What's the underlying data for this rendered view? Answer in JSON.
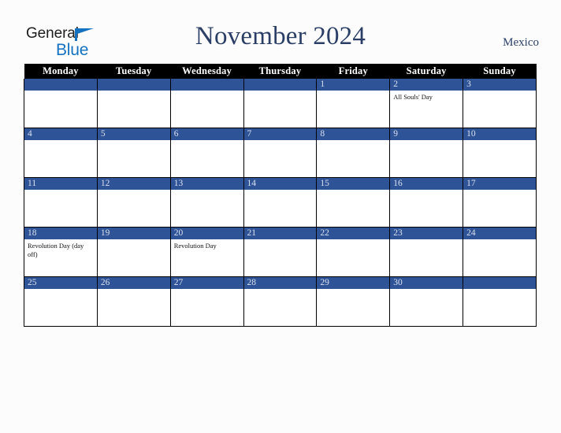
{
  "logo": {
    "word1": "General",
    "word2": "Blue",
    "triangle_icon": "triangle-right-icon",
    "color_primary": "#1472c0",
    "color_text": "#1d1d1d"
  },
  "header": {
    "title": "November 2024",
    "country": "Mexico",
    "title_color": "#2b3f66"
  },
  "calendar": {
    "header_background": "#000000",
    "daybar_background": "#2e5396",
    "weekdays": [
      "Monday",
      "Tuesday",
      "Wednesday",
      "Thursday",
      "Friday",
      "Saturday",
      "Sunday"
    ],
    "weeks": [
      [
        {
          "day": "",
          "events": []
        },
        {
          "day": "",
          "events": []
        },
        {
          "day": "",
          "events": []
        },
        {
          "day": "",
          "events": []
        },
        {
          "day": "1",
          "events": []
        },
        {
          "day": "2",
          "events": [
            "All Souls' Day"
          ]
        },
        {
          "day": "3",
          "events": []
        }
      ],
      [
        {
          "day": "4",
          "events": []
        },
        {
          "day": "5",
          "events": []
        },
        {
          "day": "6",
          "events": []
        },
        {
          "day": "7",
          "events": []
        },
        {
          "day": "8",
          "events": []
        },
        {
          "day": "9",
          "events": []
        },
        {
          "day": "10",
          "events": []
        }
      ],
      [
        {
          "day": "11",
          "events": []
        },
        {
          "day": "12",
          "events": []
        },
        {
          "day": "13",
          "events": []
        },
        {
          "day": "14",
          "events": []
        },
        {
          "day": "15",
          "events": []
        },
        {
          "day": "16",
          "events": []
        },
        {
          "day": "17",
          "events": []
        }
      ],
      [
        {
          "day": "18",
          "events": [
            "Revolution Day (day off)"
          ]
        },
        {
          "day": "19",
          "events": []
        },
        {
          "day": "20",
          "events": [
            "Revolution Day"
          ]
        },
        {
          "day": "21",
          "events": []
        },
        {
          "day": "22",
          "events": []
        },
        {
          "day": "23",
          "events": []
        },
        {
          "day": "24",
          "events": []
        }
      ],
      [
        {
          "day": "25",
          "events": []
        },
        {
          "day": "26",
          "events": []
        },
        {
          "day": "27",
          "events": []
        },
        {
          "day": "28",
          "events": []
        },
        {
          "day": "29",
          "events": []
        },
        {
          "day": "30",
          "events": []
        },
        {
          "day": "",
          "events": []
        }
      ]
    ]
  }
}
